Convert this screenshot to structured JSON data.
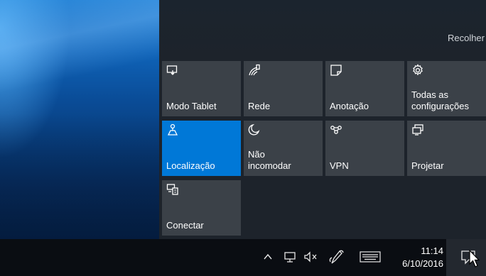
{
  "action_center": {
    "collapse_label": "Recolher",
    "tiles": [
      {
        "label": "Modo Tablet",
        "icon": "tablet-mode-icon",
        "active": false
      },
      {
        "label": "Rede",
        "icon": "network-icon",
        "active": false
      },
      {
        "label": "Anotação",
        "icon": "note-icon",
        "active": false
      },
      {
        "label": "Todas as\nconfigurações",
        "icon": "gear-icon",
        "active": false
      },
      {
        "label": "Localização",
        "icon": "location-icon",
        "active": true
      },
      {
        "label": "Não\nincomodar",
        "icon": "moon-icon",
        "active": false
      },
      {
        "label": "VPN",
        "icon": "vpn-icon",
        "active": false
      },
      {
        "label": "Projetar",
        "icon": "project-icon",
        "active": false
      },
      {
        "label": "Conectar",
        "icon": "connect-icon",
        "active": false
      }
    ]
  },
  "taskbar": {
    "time": "11:14",
    "date": "6/10/2016",
    "tray_icons": [
      "chevron-up-icon",
      "network-wired-icon",
      "volume-muted-icon",
      "pen-icon",
      "keyboard-icon"
    ],
    "notification_icon": "notification-icon"
  },
  "colors": {
    "panel": "#1d232b",
    "tile": "#3b4148",
    "tile_active": "#0078d7",
    "taskbar": "#0a0d12"
  }
}
